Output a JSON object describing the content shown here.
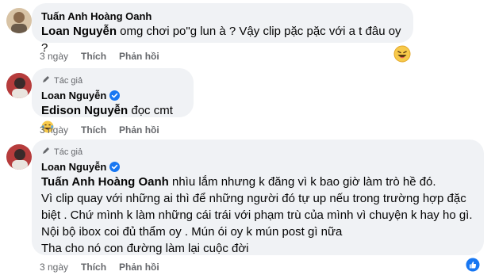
{
  "comments": [
    {
      "author": "Tuấn Anh Hoàng Oanh",
      "mention": "Loan Nguyễn",
      "text": " omg chơi po\"g lun à ? Vậy clip pặc pặc với a t đâu oy ?",
      "time": "3 ngày",
      "like_label": "Thích",
      "reply_label": "Phản hồi",
      "reaction_icon": "laughing-face-icon"
    },
    {
      "badge": "Tác giả",
      "author": "Loan Nguyễn",
      "mention": "Edison Nguyễn",
      "text": " đọc cmt",
      "time": "3 ngày",
      "like_label": "Thích",
      "reply_label": "Phản hồi"
    },
    {
      "badge": "Tác giả",
      "author": "Loan Nguyễn",
      "mention": "Tuấn Anh Hoàng Oanh",
      "lines": [
        " nhìu lắm nhưng k đăng vì k bao giờ làm trò hề đó.",
        "Vì clip quay với những ai thì để những người đó tự up nếu trong trường hợp đặc",
        "biệt . Chứ mình k làm những cái trái với phạm trù của mình vì chuyện k hay ho gì.",
        "Nội bộ ibox coi đủ thẩm oy . Mún ói oy k mún post gì nữa",
        "Tha cho nó con đường làm lại cuộc đời"
      ],
      "time": "3 ngày",
      "like_label": "Thích",
      "reply_label": "Phản hồi",
      "reaction_icon": "like-thumb-icon"
    }
  ],
  "colors": {
    "bubble": "#f0f2f5",
    "secondary_text": "#65676b",
    "verified": "#1877f2"
  }
}
